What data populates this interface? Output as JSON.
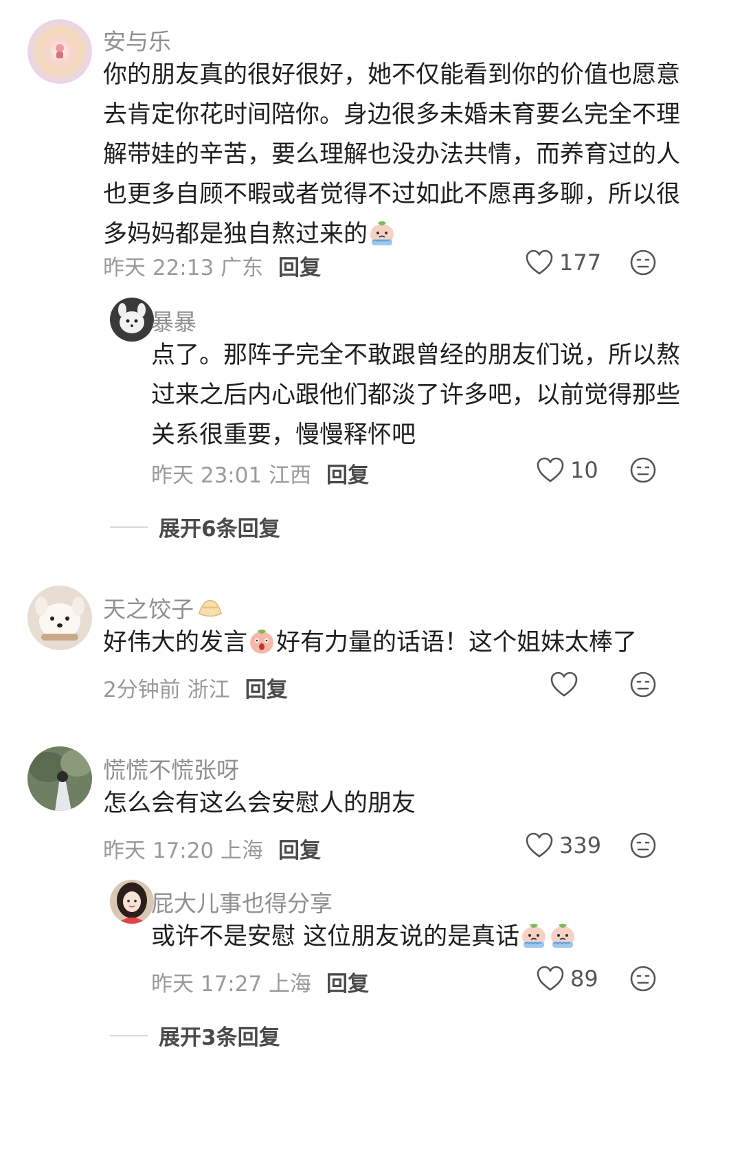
{
  "comments": [
    {
      "user": "安与乐",
      "lines": [
        "你的朋友真的很好很好，她不仅能看到你的价值也愿意",
        "去肯定你花时间陪你。身边很多未婚未育要么完全不理",
        "解带娃的辛苦，要么理解也没办法共情，而养育过的人",
        "也更多自顾不暇或者觉得不过如此不愿再多聊，所以很",
        "多妈妈都是独自熬过来的"
      ],
      "meta": "昨天 22:13 广东",
      "reply": "回复",
      "likes": "177",
      "replies": [
        {
          "user": "暴暴",
          "lines": [
            "点了。那阵子完全不敢跟曾经的朋友们说，所以熬",
            "过来之后内心跟他们都淡了许多吧，以前觉得那些",
            "关系很重要，慢慢释怀吧"
          ],
          "meta": "昨天 23:01 江西",
          "reply": "回复",
          "likes": "10"
        }
      ],
      "expand": "展开6条回复"
    },
    {
      "user": "天之饺子",
      "text_a": "好伟大的发言",
      "text_b": "好有力量的话语！这个姐妹太棒了",
      "meta": "2分钟前 浙江",
      "reply": "回复"
    },
    {
      "user": "慌慌不慌张呀",
      "lines": [
        "怎么会有这么会安慰人的朋友"
      ],
      "meta": "昨天 17:20 上海",
      "reply": "回复",
      "likes": "339",
      "replies": [
        {
          "user": "屁大儿事也得分享",
          "lines": [
            "或许不是安慰 这位朋友说的是真话"
          ],
          "meta": "昨天 17:27 上海",
          "reply": "回复",
          "likes": "89"
        }
      ],
      "expand": "展开3条回复"
    }
  ],
  "icons": {
    "like": "heart-outline-icon",
    "dislike": "unhappy-face-icon",
    "emoji_cry": "crying-face-emoji",
    "emoji_shock": "shocked-face-emoji",
    "dumpling": "dumpling-emoji"
  }
}
